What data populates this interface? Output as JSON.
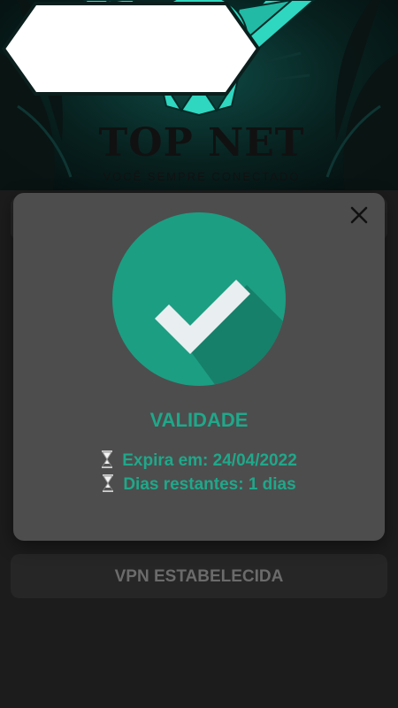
{
  "banner": {
    "title": "TOP NET",
    "subtitle": "VOCÊ SEMPRE CONECTADO",
    "mascot_icon": "owl-mascot-icon"
  },
  "dialog": {
    "title": "VALIDADE",
    "close_icon": "close-icon",
    "status_icon": "check-circle-icon",
    "expires_label": "Expira em: 24/04/2022",
    "days_left_label": "Dias restantes: 1 dias",
    "line_icon": "hourglass-icon"
  },
  "main": {
    "vpn_button_label": "VPN ESTABELECIDA"
  },
  "colors": {
    "accent": "#1fa88a",
    "check_circle": "#1c9e83",
    "check_shadow": "#16806a",
    "dialog_bg": "#4d4d4d",
    "app_bg": "#1c1c1c"
  }
}
